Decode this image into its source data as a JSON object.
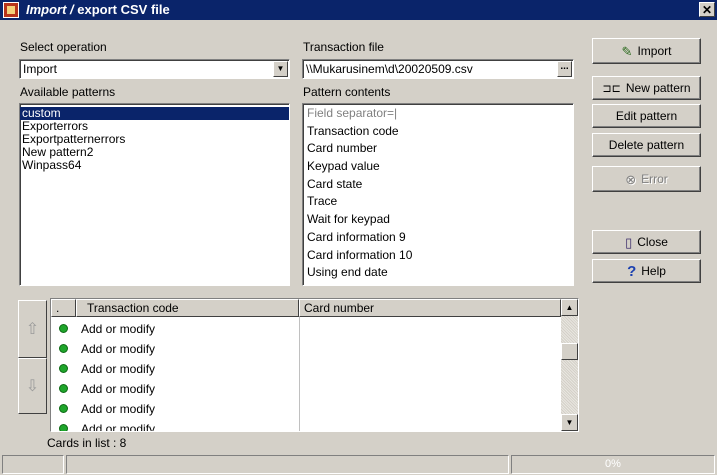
{
  "window": {
    "title_italic": "Import /",
    "title_rest": " export CSV file",
    "close_glyph": "✕"
  },
  "operation": {
    "label": "Select operation",
    "value": "Import"
  },
  "transaction_file": {
    "label": "Transaction file",
    "value": "\\\\Mukarusinem\\d\\20020509.csv",
    "browse_label": "..."
  },
  "patterns": {
    "label": "Available patterns",
    "items": [
      "custom",
      "Exporterrors",
      "Exportpatternerrors",
      "New pattern2",
      "Winpass64"
    ],
    "selected_index": 0
  },
  "pattern_contents": {
    "label": "Pattern contents",
    "items": [
      "Field separator=|",
      "Transaction code",
      "Card number",
      "Keypad value",
      "Card state",
      "Trace",
      "Wait for keypad",
      "Card information 9",
      "Card information 10",
      "Using end date"
    ]
  },
  "buttons": {
    "import": "Import",
    "new_pattern": "New pattern",
    "edit_pattern": "Edit pattern",
    "delete_pattern": "Delete pattern",
    "error": "Error",
    "close": "Close",
    "help": "Help"
  },
  "grid": {
    "columns": [
      ".",
      "Transaction code",
      "Card number"
    ],
    "rows": [
      {
        "code": "Add or modify",
        "card": ""
      },
      {
        "code": "Add or modify",
        "card": ""
      },
      {
        "code": "Add or modify",
        "card": ""
      },
      {
        "code": "Add or modify",
        "card": ""
      },
      {
        "code": "Add or modify",
        "card": ""
      },
      {
        "code": "Add or modify",
        "card": ""
      }
    ],
    "cards_in_list": "Cards in list : 8"
  },
  "statusbar": {
    "progress": "0%"
  },
  "colors": {
    "titlebar": "#0a246a",
    "face": "#d4d0c8",
    "status_dot": "#1fa52b"
  }
}
